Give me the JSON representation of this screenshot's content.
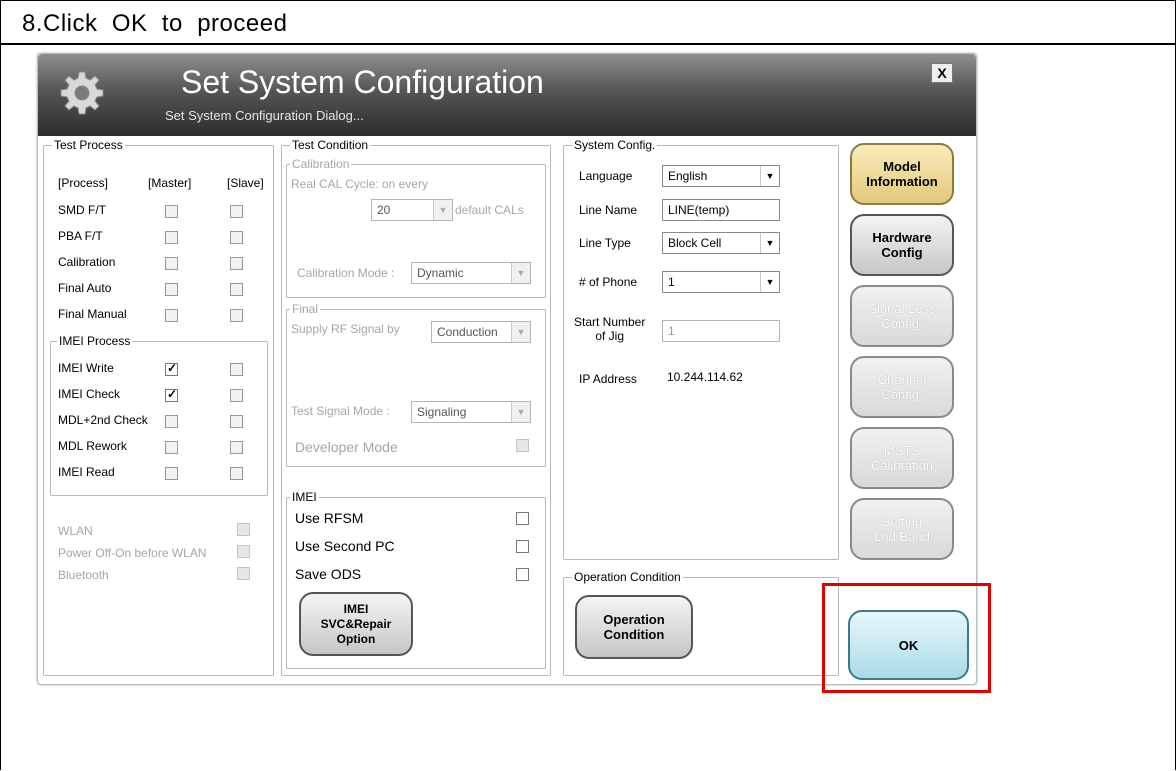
{
  "step_title": "8.Click  OK  to  proceed",
  "dialog": {
    "title": "Set System Configuration",
    "subtitle": "Set System Configuration Dialog...",
    "close_label": "X"
  },
  "test_process": {
    "legend": "Test Process",
    "col_process": "[Process]",
    "col_master": "[Master]",
    "col_slave": "[Slave]",
    "rows": [
      {
        "label": "SMD F/T",
        "master": false,
        "slave": false
      },
      {
        "label": "PBA F/T",
        "master": false,
        "slave": false
      },
      {
        "label": "Calibration",
        "master": false,
        "slave": false
      },
      {
        "label": "Final Auto",
        "master": false,
        "slave": false
      },
      {
        "label": "Final Manual",
        "master": false,
        "slave": false
      }
    ],
    "imei_legend": "IMEI Process",
    "imei_rows": [
      {
        "label": "IMEI Write",
        "master": true,
        "slave": false
      },
      {
        "label": "IMEI Check",
        "master": true,
        "slave": false
      },
      {
        "label": "MDL+2nd Check",
        "master": false,
        "slave": false
      },
      {
        "label": "MDL Rework",
        "master": false,
        "slave": false
      },
      {
        "label": "IMEI Read",
        "master": false,
        "slave": false
      }
    ],
    "extra": [
      "WLAN",
      "Power Off-On before WLAN",
      "Bluetooth"
    ]
  },
  "test_condition": {
    "legend": "Test Condition",
    "calibration_legend": "Calibration",
    "real_cal_label": "Real CAL Cycle: on every",
    "cal_count": "20",
    "default_cals": "default CALs",
    "cal_mode_label": "Calibration Mode :",
    "cal_mode_value": "Dynamic",
    "final_legend": "Final",
    "supply_label": "Supply RF Signal by",
    "supply_value": "Conduction",
    "signal_mode_label": "Test Signal Mode :",
    "signal_mode_value": "Signaling",
    "developer_mode": "Developer Mode",
    "imei_legend": "IMEI",
    "use_rfsm": "Use RFSM",
    "use_second_pc": "Use Second PC",
    "save_ods": "Save ODS",
    "imei_button": "IMEI\nSVC&Repair\nOption"
  },
  "system_config": {
    "legend": "System Config.",
    "language_label": "Language",
    "language_value": "English",
    "line_name_label": "Line Name",
    "line_name_value": "LINE(temp)",
    "line_type_label": "Line Type",
    "line_type_value": "Block Cell",
    "phone_label": "# of Phone",
    "phone_value": "1",
    "start_label": "Start Number\nof Jig",
    "start_value": "1",
    "ip_label": "IP Address",
    "ip_value": "10.244.114.62"
  },
  "operation": {
    "legend": "Operation Condition",
    "button": "Operation\nCondition"
  },
  "side_buttons": {
    "model": "Model\nInformation",
    "hardware": "Hardware\nConfig",
    "signal_loss": "Signal Loss\nConfig.",
    "channel": "Channel\nConfig.",
    "msts": "MSTS\nCalibration",
    "setting": "Setting\nLnd Band"
  },
  "ok_label": "OK",
  "colors": {
    "highlight": "#e00000",
    "model_button": "#e2c87a",
    "ok_button": "#aadbe6"
  }
}
